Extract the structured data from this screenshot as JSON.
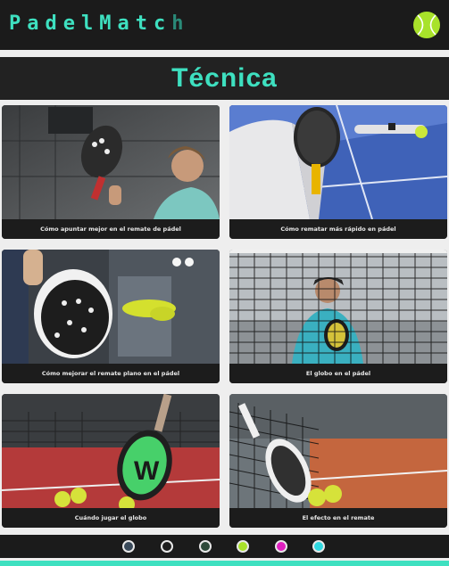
{
  "header": {
    "brand_main": "PadelMatc",
    "brand_last": "h",
    "ball_icon": "tennis-ball-icon",
    "ball_color": "#a8e22a"
  },
  "page": {
    "title": "Técnica",
    "accent": "#3ee0c0"
  },
  "cards": [
    {
      "caption": "Cómo apuntar mejor en el remate de pádel"
    },
    {
      "caption": "Cómo rematar más rápido en pádel"
    },
    {
      "caption": "Cómo mejorar el remate plano en el pádel"
    },
    {
      "caption": "El globo en el pádel"
    },
    {
      "caption": "Cuándo jugar el globo"
    },
    {
      "caption": "El efecto en el remate"
    }
  ],
  "footer": {
    "dots": [
      {
        "icon": "padel-racket-dark-icon",
        "color": "#3a4a5a"
      },
      {
        "icon": "padel-racket-black-icon",
        "color": "#1e1e1e"
      },
      {
        "icon": "padel-racket-green-icon",
        "color": "#2e4a3a"
      },
      {
        "icon": "lime-dot-icon",
        "color": "#a8e22a"
      },
      {
        "icon": "magenta-dot-icon",
        "color": "#e020c0"
      },
      {
        "icon": "cyan-dot-icon",
        "color": "#30d8e0"
      }
    ]
  }
}
